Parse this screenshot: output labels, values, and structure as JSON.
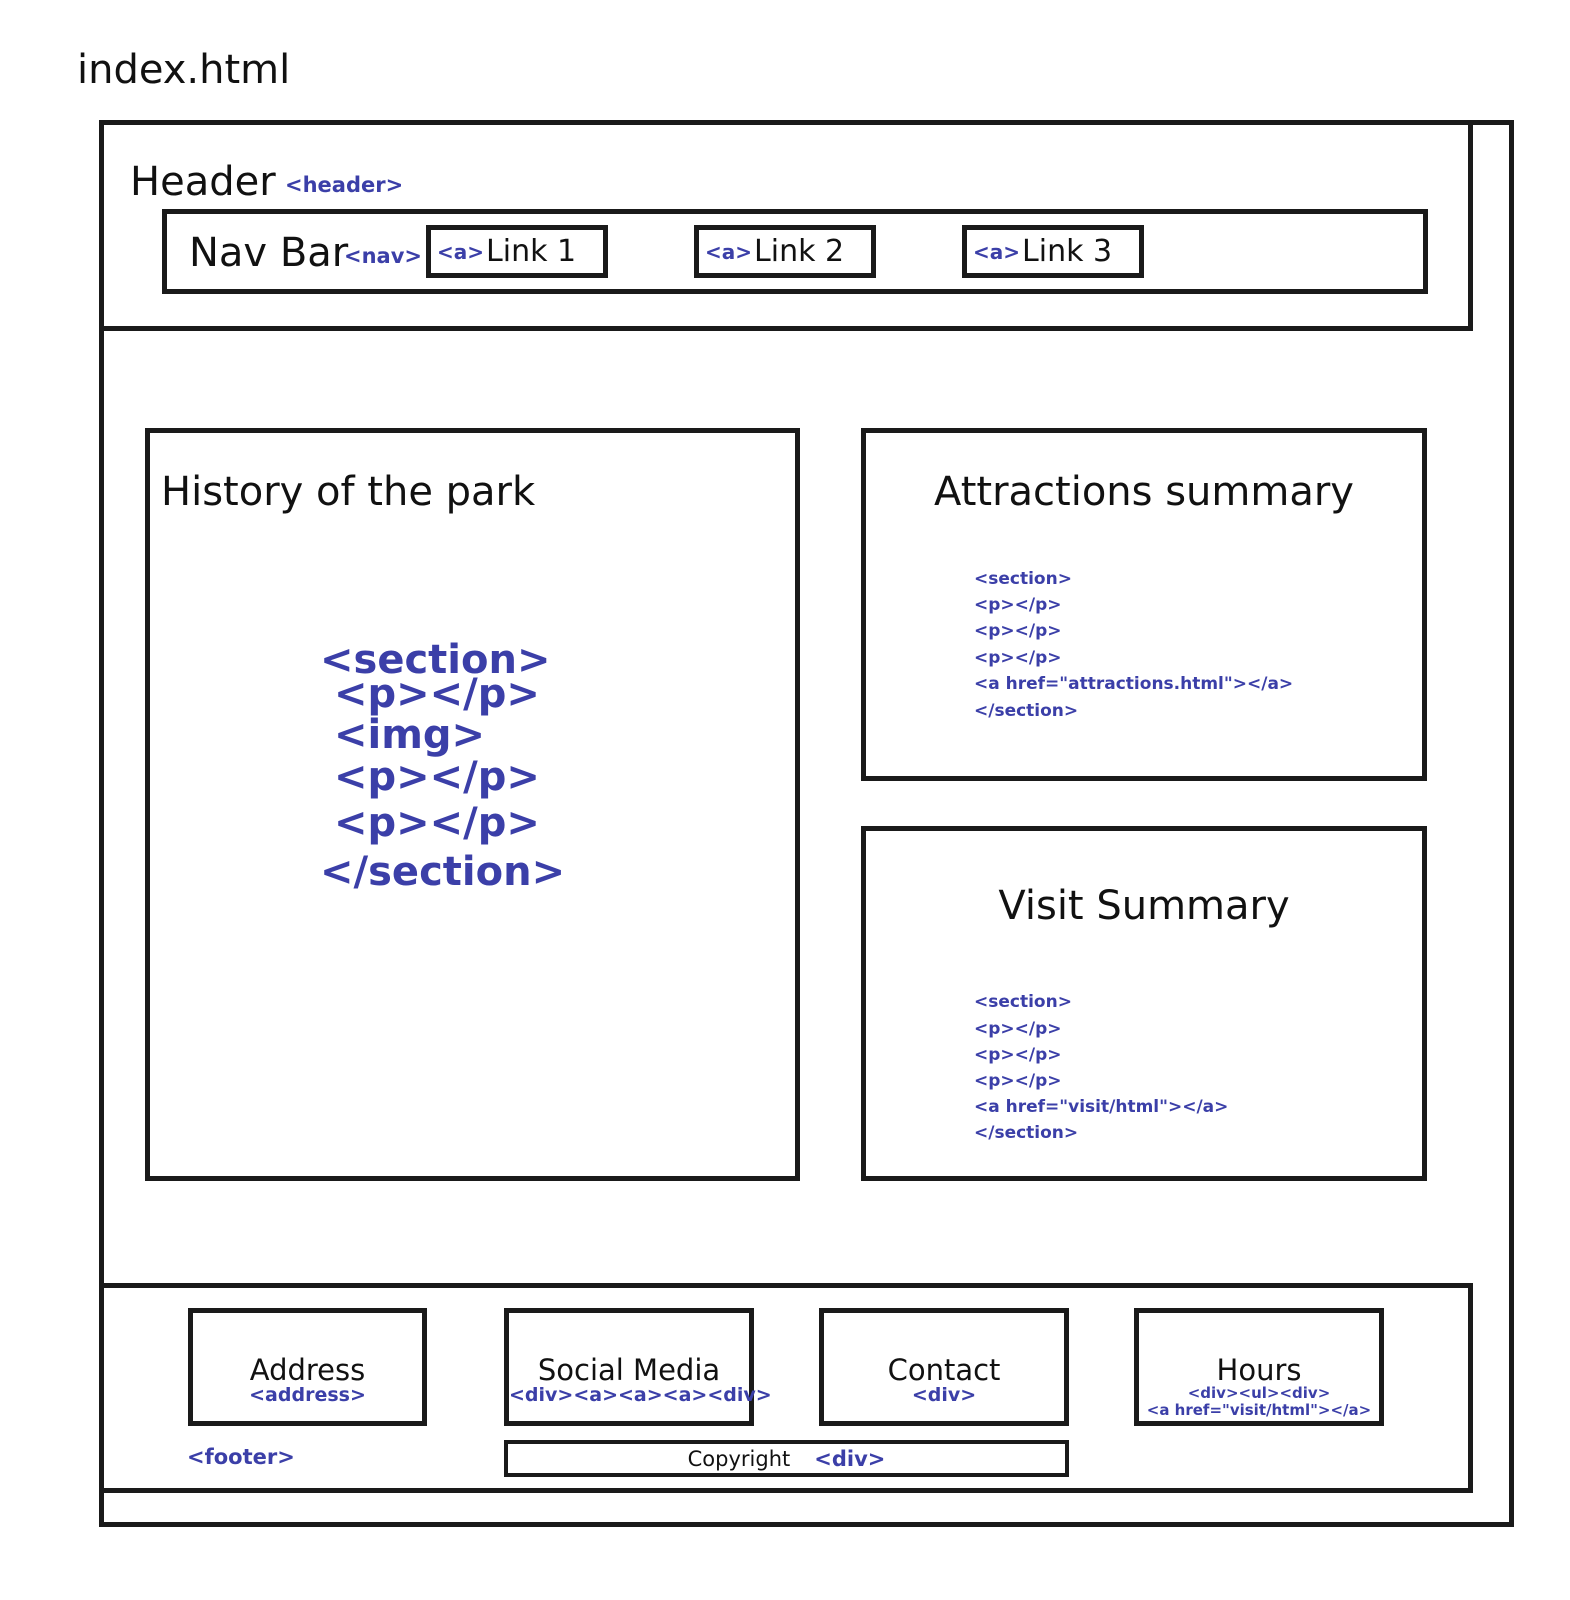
{
  "title": "index.html",
  "header": {
    "label": "Header",
    "tag": "<header>",
    "nav": {
      "label": "Nav Bar",
      "tag": "<nav>",
      "links": [
        {
          "tag": "<a>",
          "label": "Link 1"
        },
        {
          "tag": "<a>",
          "label": "Link 2"
        },
        {
          "tag": "<a>",
          "label": "Link 3"
        }
      ]
    }
  },
  "main": {
    "history": {
      "title": "History of the park",
      "code": [
        "<section>",
        "<p></p>",
        "<img>",
        "<p></p>",
        "<p></p>",
        "</section>"
      ]
    },
    "attractions": {
      "title": "Attractions summary",
      "code": [
        "<section>",
        "<p></p>",
        "<p></p>",
        "<p></p>",
        "<a href=\"attractions.html\"></a>",
        "</section>"
      ]
    },
    "visit": {
      "title": "Visit Summary",
      "code": [
        "<section>",
        "<p></p>",
        "<p></p>",
        "<p></p>",
        "<a href=\"visit/html\"></a>",
        "</section>"
      ]
    }
  },
  "footer": {
    "tag": "<footer>",
    "address": {
      "label": "Address",
      "tag": "<address>"
    },
    "social": {
      "label": "Social Media",
      "tag": "<div><a><a><a><div>"
    },
    "contact": {
      "label": "Contact",
      "tag": "<div>"
    },
    "hours": {
      "label": "Hours",
      "tag_line1": "<div><ul><div>",
      "tag_line2": "<a href=\"visit/html\"></a>"
    },
    "copyright": {
      "label": "Copyright",
      "tag": "<div>"
    }
  },
  "colors": {
    "tag_blue": "#3b3fa8",
    "border": "#1a1a1a"
  }
}
